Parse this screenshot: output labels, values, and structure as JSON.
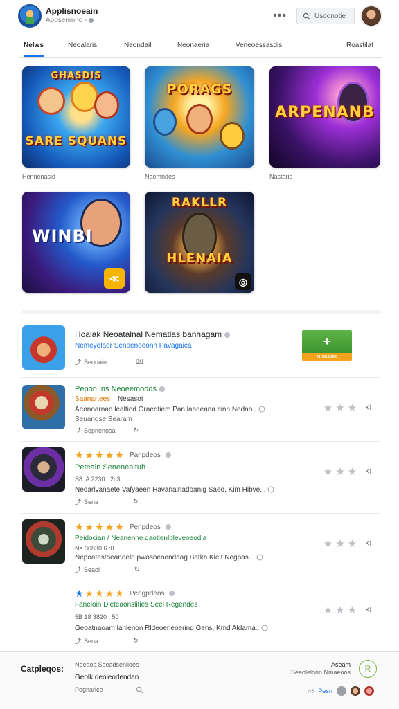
{
  "header": {
    "title": "Applisnoeain",
    "subtitle": "Appsenmno -",
    "menu_icon": "more-horizontal-icon",
    "search_label": "Usoonotie",
    "search_icon": "search-icon"
  },
  "tabs": [
    {
      "label": "Nelws",
      "active": true
    },
    {
      "label": "Neoalaris"
    },
    {
      "label": "Neondail"
    },
    {
      "label": "Neonaeria"
    },
    {
      "label": "Veneoessasdis"
    },
    {
      "label": "Roastilat"
    }
  ],
  "grid": [
    {
      "art": "SARE SQUANS",
      "art_top": "GHASDIS",
      "label": "Hennenasid"
    },
    {
      "art": "PORAGS",
      "label": "Naemndes"
    },
    {
      "art": "ARPENANB",
      "label": "Nastaris"
    },
    {
      "art": "WINBI",
      "label": ""
    },
    {
      "art": "HLENAIA",
      "art_top": "RAKLLR",
      "label": ""
    }
  ],
  "list": [
    {
      "title": "Hoalak Neoatalnal Nematlas banhagam",
      "subtitle": "Nemeyelaer Senoenoeonn Pavagaica",
      "meta": "Seonain",
      "install_label": "+",
      "install_sub": "Nnatalles"
    },
    {
      "title": "Pepon Ins Neoeemodds",
      "subtitle_left": "Saanartees",
      "subtitle_right": "Nesasot",
      "text": "Aeonoarnao lealtiod Oraedtiem Pan.laadeana cinn Nedao .",
      "text2": "Seuanose Searam",
      "meta": "Sepnenosa",
      "right_label": "Kl"
    },
    {
      "stars": 5,
      "stars_label": "Panpdeos",
      "title": "Peteain Senenealtuh",
      "subtitle": "S8. A 2230 : 2c3",
      "text": "Neoarivanaete Vafyaeen Havanalnadoanig Saeo, Kim Hibve...",
      "meta": "Sena",
      "right_label": "Kl"
    },
    {
      "stars": 5,
      "stars_label": "Penpdeos",
      "title": "Peidocian / Neanenne daotlenlbleveoeodla",
      "subtitle": "Ne 30830 6 :0",
      "text": "Nepoatestoeanoeln.pwosneoondaag Batka Klelt Negpas...",
      "meta": "Seaol",
      "right_label": "Kl"
    },
    {
      "stars": 5,
      "first_star_blue": true,
      "stars_label": "Pengpdeos",
      "title": "Faneloin Dieteaonslities Seel Regendes",
      "subtitle": "5B 18 3820 : 50",
      "text": "Geoatnaoam lanlenon Rldeoerleoering Gens, Kmd Aldama..",
      "meta": "Sena",
      "right_label": "Kl"
    }
  ],
  "footer": {
    "label": "Catpleqos:",
    "text1": "Noeaos Seeadsenlides",
    "text2": "Geolk deoleodendan",
    "text3": "Pegnarice",
    "right1": "Aseam",
    "right2": "Seaolelonn Nmaeoos",
    "circle_label": "R",
    "bottom_label": "Pesn"
  },
  "colors": {
    "accent": "#1a73e8",
    "green": "#188038",
    "star": "#f4a21a",
    "install": "#4caf50"
  }
}
